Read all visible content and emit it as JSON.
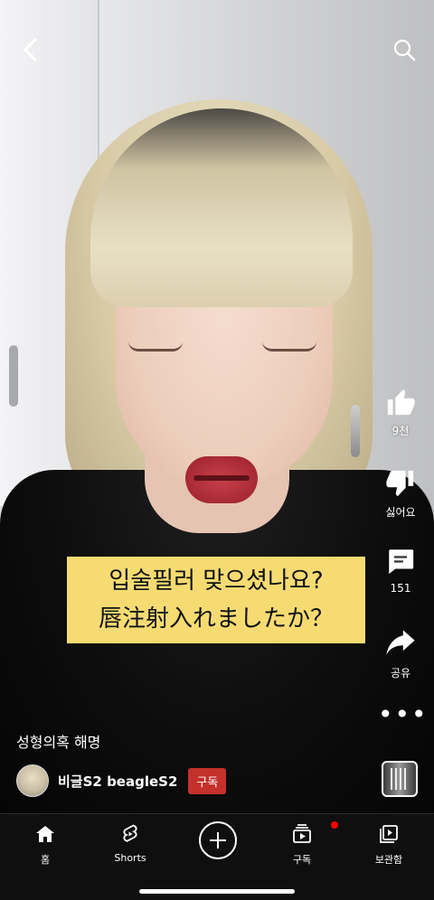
{
  "caption": {
    "line1": "입술필러 맞으셨나요?",
    "line2": "唇注射入れましたか？"
  },
  "actions": {
    "like_count": "9천",
    "dislike_label": "싫어요",
    "comment_count": "151",
    "share_label": "공유"
  },
  "video": {
    "title": "성형의혹 해명",
    "channel_name": "비글S2 beagleS2",
    "subscribe_label": "구독"
  },
  "nav": {
    "home": "홈",
    "shorts": "Shorts",
    "subscriptions": "구독",
    "library": "보관함"
  },
  "colors": {
    "caption_bg": "#f6db72",
    "subscribe_bg": "#c4302b",
    "nav_bg": "#0f0f0f"
  }
}
